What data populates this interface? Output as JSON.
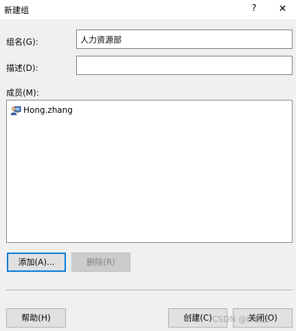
{
  "window": {
    "title": "新建组",
    "help_glyph": "?",
    "close_glyph": "✕"
  },
  "form": {
    "group_name_label": "组名(G):",
    "group_name_value": "人力资源部",
    "description_label": "描述(D):",
    "description_value": "",
    "members_label": "成员(M):"
  },
  "members": [
    {
      "name": "Hong.zhang",
      "icon": "user-icon"
    }
  ],
  "buttons": {
    "add": "添加(A)...",
    "remove": "删除(R)",
    "help": "帮助(H)",
    "create": "创建(C)",
    "close": "关闭(O)"
  },
  "watermark": "CSDN @IT张三"
}
